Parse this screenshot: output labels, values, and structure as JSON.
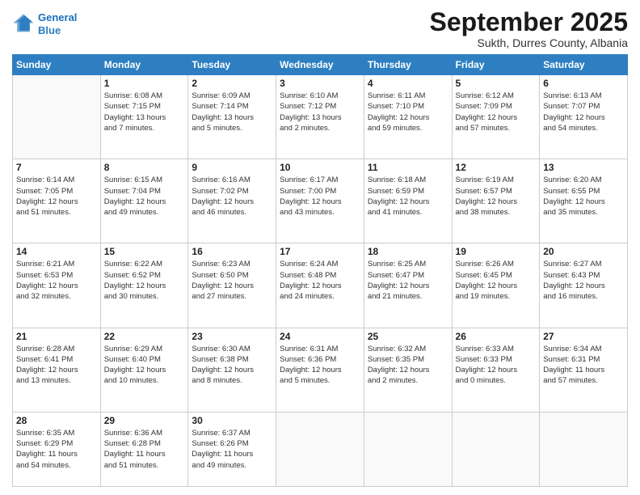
{
  "logo": {
    "line1": "General",
    "line2": "Blue"
  },
  "title": "September 2025",
  "subtitle": "Sukth, Durres County, Albania",
  "days_header": [
    "Sunday",
    "Monday",
    "Tuesday",
    "Wednesday",
    "Thursday",
    "Friday",
    "Saturday"
  ],
  "weeks": [
    [
      {
        "num": "",
        "info": ""
      },
      {
        "num": "1",
        "info": "Sunrise: 6:08 AM\nSunset: 7:15 PM\nDaylight: 13 hours\nand 7 minutes."
      },
      {
        "num": "2",
        "info": "Sunrise: 6:09 AM\nSunset: 7:14 PM\nDaylight: 13 hours\nand 5 minutes."
      },
      {
        "num": "3",
        "info": "Sunrise: 6:10 AM\nSunset: 7:12 PM\nDaylight: 13 hours\nand 2 minutes."
      },
      {
        "num": "4",
        "info": "Sunrise: 6:11 AM\nSunset: 7:10 PM\nDaylight: 12 hours\nand 59 minutes."
      },
      {
        "num": "5",
        "info": "Sunrise: 6:12 AM\nSunset: 7:09 PM\nDaylight: 12 hours\nand 57 minutes."
      },
      {
        "num": "6",
        "info": "Sunrise: 6:13 AM\nSunset: 7:07 PM\nDaylight: 12 hours\nand 54 minutes."
      }
    ],
    [
      {
        "num": "7",
        "info": "Sunrise: 6:14 AM\nSunset: 7:05 PM\nDaylight: 12 hours\nand 51 minutes."
      },
      {
        "num": "8",
        "info": "Sunrise: 6:15 AM\nSunset: 7:04 PM\nDaylight: 12 hours\nand 49 minutes."
      },
      {
        "num": "9",
        "info": "Sunrise: 6:16 AM\nSunset: 7:02 PM\nDaylight: 12 hours\nand 46 minutes."
      },
      {
        "num": "10",
        "info": "Sunrise: 6:17 AM\nSunset: 7:00 PM\nDaylight: 12 hours\nand 43 minutes."
      },
      {
        "num": "11",
        "info": "Sunrise: 6:18 AM\nSunset: 6:59 PM\nDaylight: 12 hours\nand 41 minutes."
      },
      {
        "num": "12",
        "info": "Sunrise: 6:19 AM\nSunset: 6:57 PM\nDaylight: 12 hours\nand 38 minutes."
      },
      {
        "num": "13",
        "info": "Sunrise: 6:20 AM\nSunset: 6:55 PM\nDaylight: 12 hours\nand 35 minutes."
      }
    ],
    [
      {
        "num": "14",
        "info": "Sunrise: 6:21 AM\nSunset: 6:53 PM\nDaylight: 12 hours\nand 32 minutes."
      },
      {
        "num": "15",
        "info": "Sunrise: 6:22 AM\nSunset: 6:52 PM\nDaylight: 12 hours\nand 30 minutes."
      },
      {
        "num": "16",
        "info": "Sunrise: 6:23 AM\nSunset: 6:50 PM\nDaylight: 12 hours\nand 27 minutes."
      },
      {
        "num": "17",
        "info": "Sunrise: 6:24 AM\nSunset: 6:48 PM\nDaylight: 12 hours\nand 24 minutes."
      },
      {
        "num": "18",
        "info": "Sunrise: 6:25 AM\nSunset: 6:47 PM\nDaylight: 12 hours\nand 21 minutes."
      },
      {
        "num": "19",
        "info": "Sunrise: 6:26 AM\nSunset: 6:45 PM\nDaylight: 12 hours\nand 19 minutes."
      },
      {
        "num": "20",
        "info": "Sunrise: 6:27 AM\nSunset: 6:43 PM\nDaylight: 12 hours\nand 16 minutes."
      }
    ],
    [
      {
        "num": "21",
        "info": "Sunrise: 6:28 AM\nSunset: 6:41 PM\nDaylight: 12 hours\nand 13 minutes."
      },
      {
        "num": "22",
        "info": "Sunrise: 6:29 AM\nSunset: 6:40 PM\nDaylight: 12 hours\nand 10 minutes."
      },
      {
        "num": "23",
        "info": "Sunrise: 6:30 AM\nSunset: 6:38 PM\nDaylight: 12 hours\nand 8 minutes."
      },
      {
        "num": "24",
        "info": "Sunrise: 6:31 AM\nSunset: 6:36 PM\nDaylight: 12 hours\nand 5 minutes."
      },
      {
        "num": "25",
        "info": "Sunrise: 6:32 AM\nSunset: 6:35 PM\nDaylight: 12 hours\nand 2 minutes."
      },
      {
        "num": "26",
        "info": "Sunrise: 6:33 AM\nSunset: 6:33 PM\nDaylight: 12 hours\nand 0 minutes."
      },
      {
        "num": "27",
        "info": "Sunrise: 6:34 AM\nSunset: 6:31 PM\nDaylight: 11 hours\nand 57 minutes."
      }
    ],
    [
      {
        "num": "28",
        "info": "Sunrise: 6:35 AM\nSunset: 6:29 PM\nDaylight: 11 hours\nand 54 minutes."
      },
      {
        "num": "29",
        "info": "Sunrise: 6:36 AM\nSunset: 6:28 PM\nDaylight: 11 hours\nand 51 minutes."
      },
      {
        "num": "30",
        "info": "Sunrise: 6:37 AM\nSunset: 6:26 PM\nDaylight: 11 hours\nand 49 minutes."
      },
      {
        "num": "",
        "info": ""
      },
      {
        "num": "",
        "info": ""
      },
      {
        "num": "",
        "info": ""
      },
      {
        "num": "",
        "info": ""
      }
    ]
  ]
}
